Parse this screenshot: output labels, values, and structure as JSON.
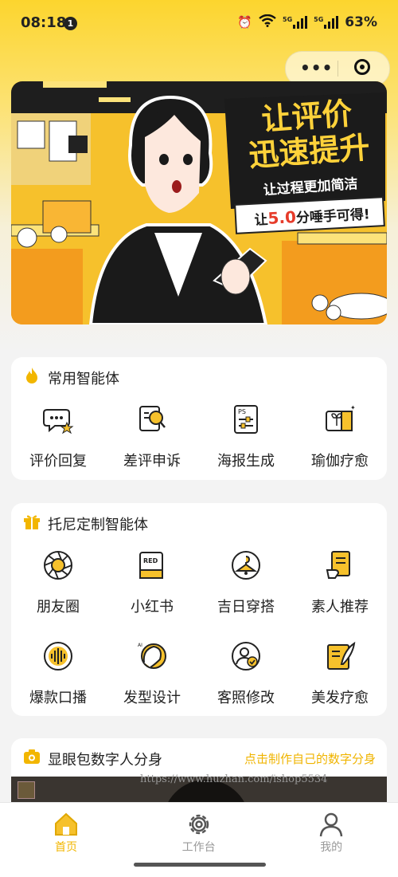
{
  "status": {
    "time": "08:18",
    "notif_count": "1",
    "battery": "63%",
    "net1": "5G",
    "net2": "5G"
  },
  "capsule": {
    "more_icon": "more-icon",
    "close_icon": "target-icon"
  },
  "banner": {
    "line1": "让评价",
    "line2": "迅速提升",
    "line3": "让过程更加简洁",
    "line4_pre": "让",
    "line4_num": "5.0",
    "line4_post": "分唾手可得!"
  },
  "common_agents": {
    "title": "常用智能体",
    "items": [
      {
        "label": "评价回复",
        "icon": "chat-bubble-star-icon"
      },
      {
        "label": "差评申诉",
        "icon": "document-search-icon"
      },
      {
        "label": "海报生成",
        "icon": "poster-ps-icon"
      },
      {
        "label": "瑜伽疗愈",
        "icon": "gift-card-icon"
      }
    ]
  },
  "custom_agents": {
    "title": "托尼定制智能体",
    "items": [
      {
        "label": "朋友圈",
        "icon": "aperture-icon"
      },
      {
        "label": "小红书",
        "icon": "red-book-icon"
      },
      {
        "label": "吉日穿搭",
        "icon": "hanger-icon"
      },
      {
        "label": "素人推荐",
        "icon": "scroll-hand-icon"
      },
      {
        "label": "爆款口播",
        "icon": "voice-wave-icon"
      },
      {
        "label": "发型设计",
        "icon": "hair-ai-icon"
      },
      {
        "label": "客照修改",
        "icon": "user-check-icon"
      },
      {
        "label": "美发疗愈",
        "icon": "book-feather-icon"
      }
    ]
  },
  "digital": {
    "title": "显眼包数字人分身",
    "link": "点击制作自己的数字分身"
  },
  "watermark": "https://www.huzhan.com/ishop5534",
  "tabs": [
    {
      "label": "首页",
      "icon": "home-icon",
      "active": true
    },
    {
      "label": "工作台",
      "icon": "gear-icon",
      "active": false
    },
    {
      "label": "我的",
      "icon": "user-icon",
      "active": false
    }
  ],
  "colors": {
    "accent": "#f2b600",
    "banner_bg": "#f7c331",
    "dark": "#222222"
  }
}
